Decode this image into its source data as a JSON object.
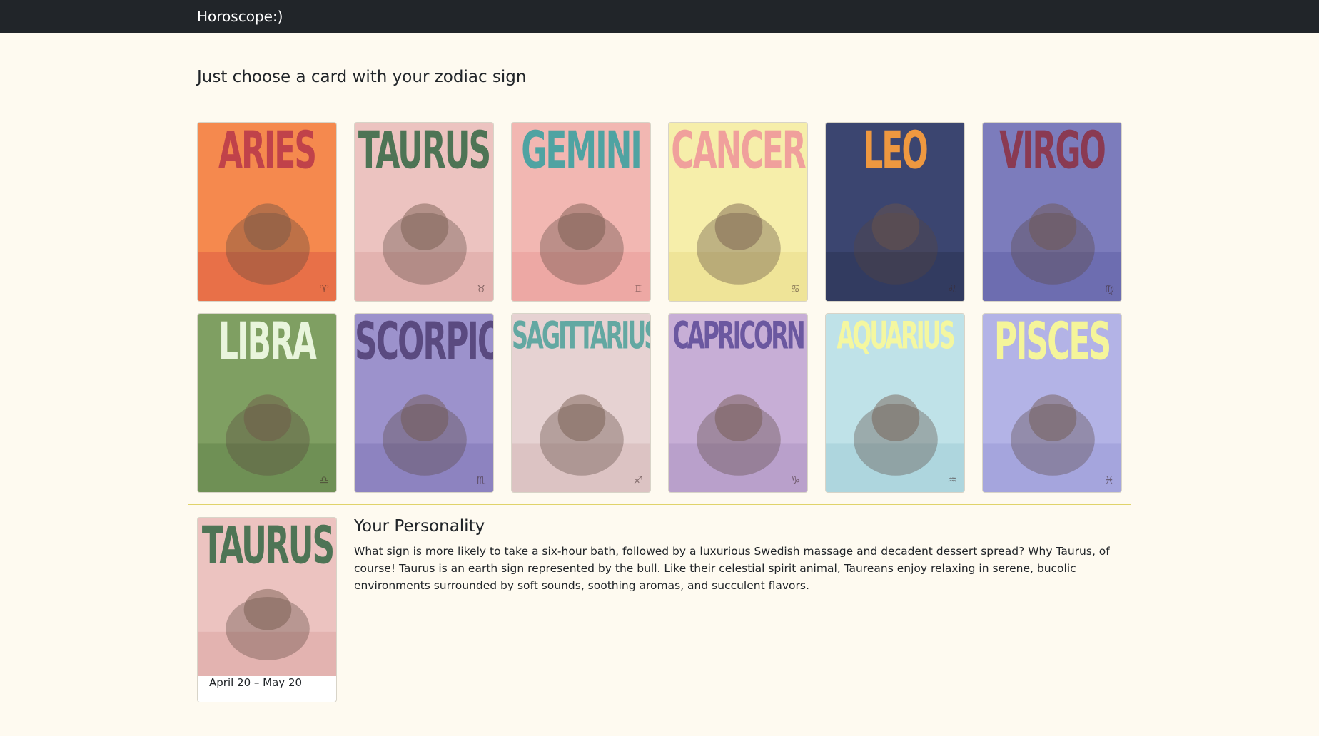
{
  "navbar": {
    "brand": "Horoscope:)"
  },
  "heading": "Just choose a card with your zodiac sign",
  "cards": [
    {
      "name": "ARIES",
      "glyph": "♈",
      "colors": {
        "bg": "#f5894e",
        "title": "#c0424a",
        "band": "#e87048"
      }
    },
    {
      "name": "TAURUS",
      "glyph": "♉",
      "colors": {
        "bg": "#ecc3c0",
        "title": "#4e7455",
        "band": "#e3b3b0"
      }
    },
    {
      "name": "GEMINI",
      "glyph": "♊",
      "colors": {
        "bg": "#f2b7b2",
        "title": "#4fa3a2",
        "band": "#eda8a4"
      }
    },
    {
      "name": "CANCER",
      "glyph": "♋",
      "colors": {
        "bg": "#f6eeaa",
        "title": "#f0a09c",
        "band": "#efe498"
      }
    },
    {
      "name": "LEO",
      "glyph": "♌",
      "colors": {
        "bg": "#3b4570",
        "title": "#ee9840",
        "band": "#323b60"
      }
    },
    {
      "name": "VIRGO",
      "glyph": "♍",
      "colors": {
        "bg": "#7c7cbc",
        "title": "#8a3a52",
        "band": "#6d6db0"
      }
    },
    {
      "name": "LIBRA",
      "glyph": "♎",
      "colors": {
        "bg": "#7f9f62",
        "title": "#e9f5dc",
        "band": "#6f9055"
      }
    },
    {
      "name": "SCORPIO",
      "glyph": "♏",
      "colors": {
        "bg": "#9c92cc",
        "title": "#5a4a80",
        "band": "#8d83c0"
      }
    },
    {
      "name": "SAGITTARIUS",
      "glyph": "♐",
      "colors": {
        "bg": "#e6d2d2",
        "title": "#63a8a2",
        "band": "#dcc3c3"
      }
    },
    {
      "name": "CAPRICORN",
      "glyph": "♑",
      "colors": {
        "bg": "#c7aed6",
        "title": "#6b58a0",
        "band": "#b9a0cb"
      }
    },
    {
      "name": "AQUARIUS",
      "glyph": "♒",
      "colors": {
        "bg": "#bfe2e8",
        "title": "#f4f7a0",
        "band": "#aed6de"
      }
    },
    {
      "name": "PISCES",
      "glyph": "♓",
      "colors": {
        "bg": "#b3b3e6",
        "title": "#f5f59a",
        "band": "#a5a5dd"
      }
    }
  ],
  "selected": {
    "name": "TAURUS",
    "dates": "April 20 – May 20",
    "title": "Your Personality",
    "text": "What sign is more likely to take a six-hour bath, followed by a luxurious Swedish massage and decadent dessert spread? Why Taurus, of course! Taurus is an earth sign represented by the bull. Like their celestial spirit animal, Taureans enjoy relaxing in serene, bucolic environments surrounded by soft sounds, soothing aromas, and succulent flavors.",
    "colors": {
      "bg": "#ecc3c0",
      "title": "#4e7455",
      "band": "#e3b3b0"
    }
  }
}
